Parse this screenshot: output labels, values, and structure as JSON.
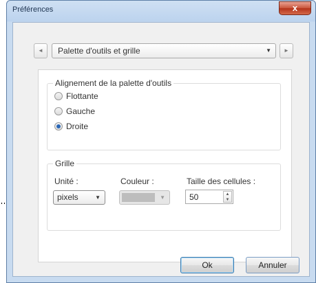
{
  "window": {
    "title": "Préférences",
    "close_label": "x"
  },
  "nav": {
    "prev_label": "◄",
    "next_label": "►",
    "page_select": "Palette d'outils et grille"
  },
  "alignment_group": {
    "label": "Alignement de la palette d'outils",
    "options": [
      {
        "label": "Flottante",
        "checked": false
      },
      {
        "label": "Gauche",
        "checked": false
      },
      {
        "label": "Droite",
        "checked": true
      }
    ]
  },
  "grid_group": {
    "label": "Grille",
    "unit_label": "Unité :",
    "unit_value": "pixels",
    "color_label": "Couleur :",
    "cell_size_label": "Taille des cellules :",
    "cell_size_value": "50"
  },
  "buttons": {
    "ok": "Ok",
    "cancel": "Annuler"
  },
  "icons": {
    "dropdown_arrow": "▼",
    "spin_up": "▲",
    "spin_down": "▼"
  },
  "colors": {
    "accent": "#2a66b5",
    "close_button": "#c9543a"
  }
}
